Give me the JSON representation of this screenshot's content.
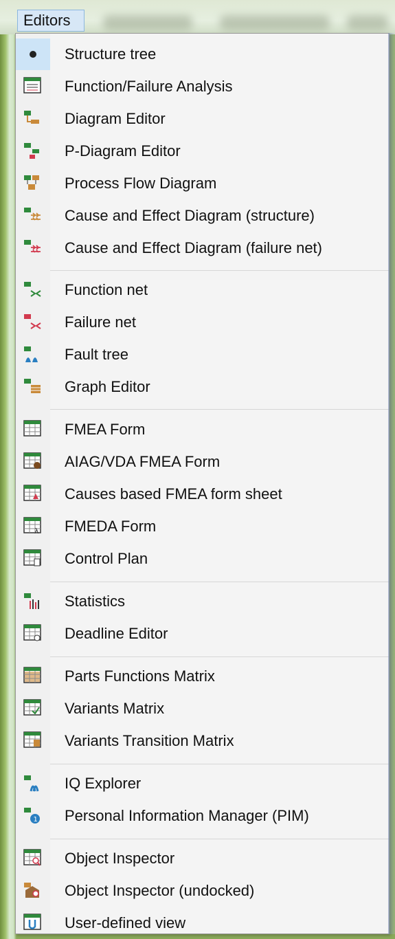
{
  "menubar": {
    "active_label": "Editors"
  },
  "menu": {
    "items": [
      {
        "label": "Structure tree",
        "icon": "bullet-icon",
        "selected": true
      },
      {
        "label": "Function/Failure Analysis",
        "icon": "function-failure-analysis-icon"
      },
      {
        "label": "Diagram Editor",
        "icon": "diagram-editor-icon"
      },
      {
        "label": "P-Diagram Editor",
        "icon": "p-diagram-editor-icon"
      },
      {
        "label": "Process Flow Diagram",
        "icon": "process-flow-diagram-icon"
      },
      {
        "label": "Cause and Effect Diagram (structure)",
        "icon": "cause-effect-structure-icon"
      },
      {
        "label": "Cause and Effect Diagram (failure net)",
        "icon": "cause-effect-failure-net-icon"
      },
      {
        "label": "Function net",
        "icon": "function-net-icon"
      },
      {
        "label": "Failure net",
        "icon": "failure-net-icon"
      },
      {
        "label": "Fault tree",
        "icon": "fault-tree-icon"
      },
      {
        "label": "Graph Editor",
        "icon": "graph-editor-icon"
      },
      {
        "label": "FMEA Form",
        "icon": "fmea-form-icon"
      },
      {
        "label": "AIAG/VDA FMEA Form",
        "icon": "aiag-vda-fmea-form-icon"
      },
      {
        "label": "Causes based FMEA form sheet",
        "icon": "causes-fmea-form-icon"
      },
      {
        "label": "FMEDA Form",
        "icon": "fmeda-form-icon"
      },
      {
        "label": "Control Plan",
        "icon": "control-plan-icon"
      },
      {
        "label": "Statistics",
        "icon": "statistics-icon"
      },
      {
        "label": "Deadline Editor",
        "icon": "deadline-editor-icon"
      },
      {
        "label": "Parts Functions Matrix",
        "icon": "parts-functions-matrix-icon"
      },
      {
        "label": "Variants Matrix",
        "icon": "variants-matrix-icon"
      },
      {
        "label": "Variants Transition Matrix",
        "icon": "variants-transition-matrix-icon"
      },
      {
        "label": "IQ Explorer",
        "icon": "iq-explorer-icon"
      },
      {
        "label": "Personal Information Manager (PIM)",
        "icon": "pim-icon"
      },
      {
        "label": "Object Inspector",
        "icon": "object-inspector-icon"
      },
      {
        "label": "Object Inspector (undocked)",
        "icon": "object-inspector-undocked-icon"
      },
      {
        "label": "User-defined view",
        "icon": "user-defined-view-icon"
      }
    ]
  }
}
